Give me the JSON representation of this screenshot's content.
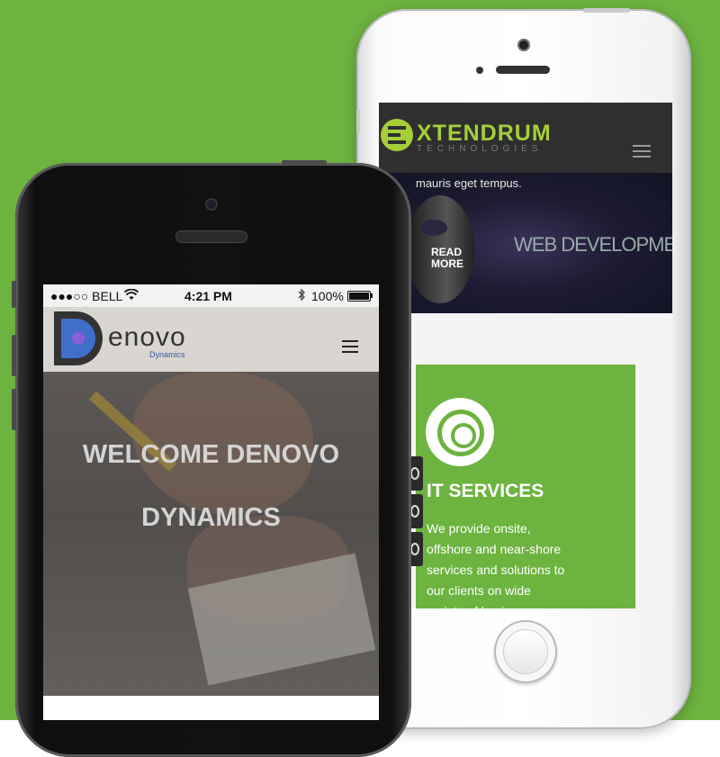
{
  "back_phone": {
    "brand_title": "XTENDRUM",
    "brand_subtitle": "TECHNOLOGIES",
    "hero_text": "mauris eget tempus.",
    "read_more": "READ MORE",
    "hero_banner_text": "WEB DEVELOPMENT",
    "service_title": "IT SERVICES",
    "service_description": "We provide onsite, offshore and near-shore services and solutions to our clients on wide variety of business"
  },
  "front_phone": {
    "status_bar": {
      "carrier": "●●●○○ BELL",
      "time": "4:21 PM",
      "battery": "100%"
    },
    "logo_name": "enovo",
    "logo_sub": "Dynamics",
    "hero_line1": "WELCOME DENOVO",
    "hero_line2": "DYNAMICS"
  },
  "colors": {
    "background": "#6db33f",
    "brand_green": "#a6ce39",
    "service_card": "#6db33f",
    "denovo_blue": "#3f6fc9"
  }
}
